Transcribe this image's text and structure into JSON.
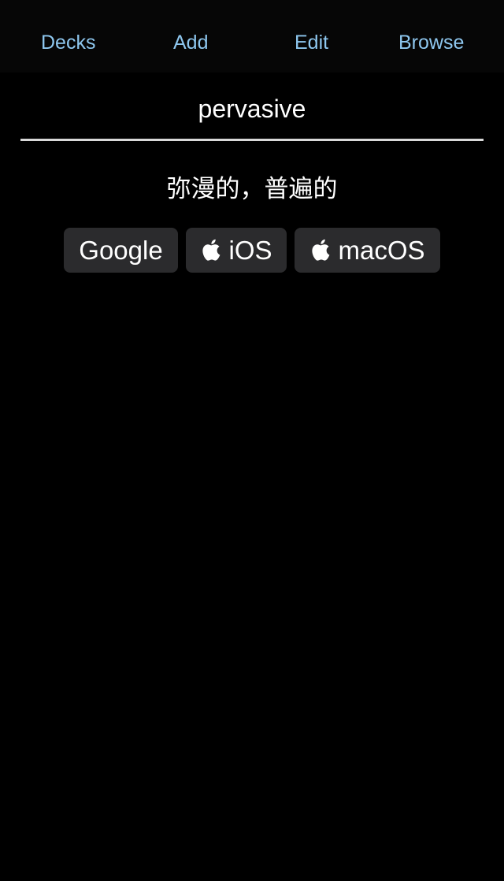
{
  "nav": {
    "decks_label": "Decks",
    "add_label": "Add",
    "edit_label": "Edit",
    "browse_label": "Browse"
  },
  "card": {
    "front": "pervasive",
    "back": "弥漫的，普遍的"
  },
  "lookup_buttons": {
    "google_label": "Google",
    "ios_label": "iOS",
    "macos_label": "macOS"
  },
  "colors": {
    "link": "#8ec7ef",
    "button_bg": "#2b2b2d",
    "background": "#000000"
  },
  "icons": {
    "ios_icon": "apple-icon",
    "macos_icon": "apple-icon"
  }
}
